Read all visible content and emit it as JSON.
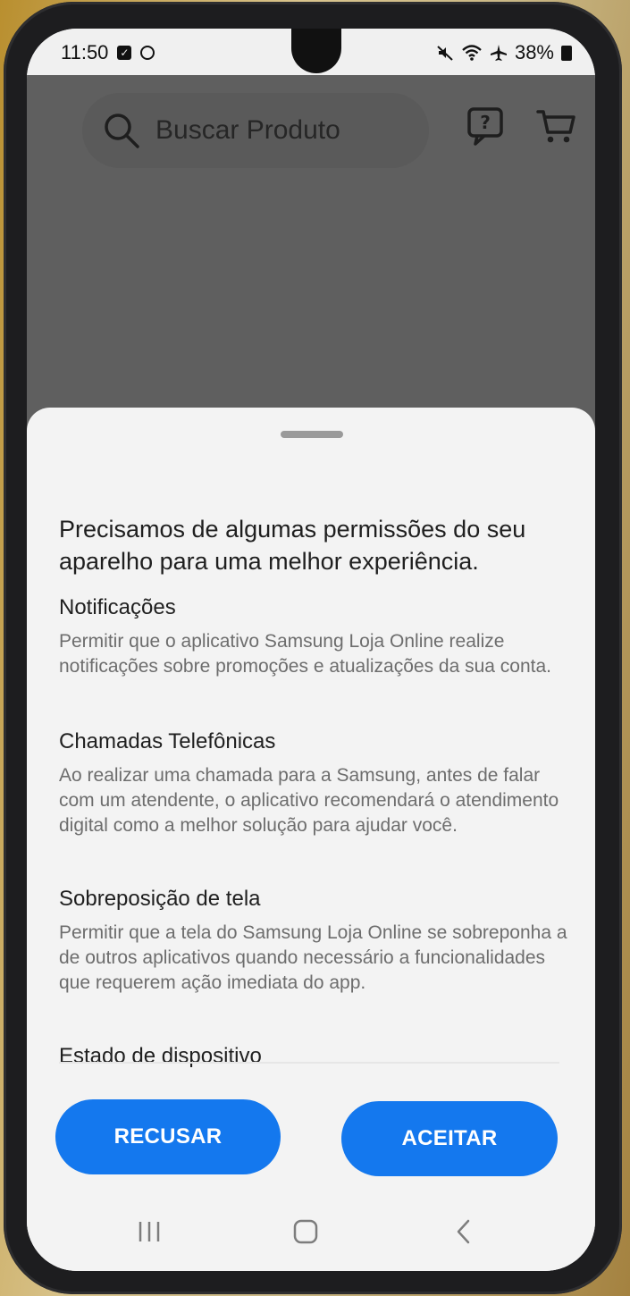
{
  "status_bar": {
    "time": "11:50",
    "battery": "38%"
  },
  "header": {
    "search_placeholder": "Buscar Produto"
  },
  "sheet": {
    "title": "Precisamos de algumas permissões do seu aparelho para uma melhor experiência.",
    "permissions": [
      {
        "title": "Notificações",
        "body": "Permitir que o aplicativo Samsung Loja Online realize notificações sobre promoções e atualizações da sua conta."
      },
      {
        "title": "Chamadas Telefônicas",
        "body": "Ao realizar uma chamada para a Samsung, antes de falar com um atendente, o aplicativo recomendará o atendimento digital como a melhor solução para ajudar você."
      },
      {
        "title": "Sobreposição de tela",
        "body": "Permitir que a tela do Samsung Loja Online se sobreponha a de outros aplicativos quando necessário a funcionalidades que requerem ação imediata do app."
      },
      {
        "title": "Estado de dispositivo",
        "body": ""
      }
    ],
    "decline_label": "RECUSAR",
    "accept_label": "ACEITAR"
  },
  "colors": {
    "accent": "#1478ee",
    "overlay": "#5f5f5f",
    "sheet_background": "#f3f3f3"
  },
  "icons": {
    "search": "search-icon",
    "chat_help": "chat-question-icon",
    "cart": "cart-icon",
    "nav_recents": "recents-icon",
    "nav_home": "home-icon",
    "nav_back": "back-icon"
  }
}
